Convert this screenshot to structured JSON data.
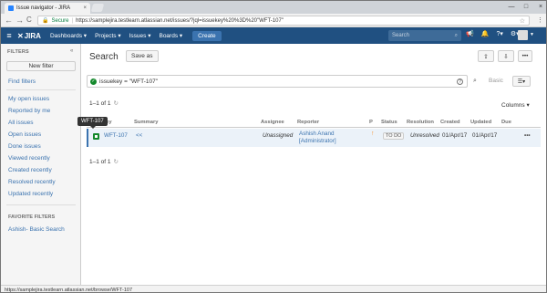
{
  "browser": {
    "tab_title": "Issue navigator - JIRA",
    "tab_close": "×",
    "window_controls": [
      "—",
      "□",
      "×"
    ],
    "back_glyph": "←",
    "forward_glyph": "→",
    "reload_glyph": "C",
    "secure_label": "Secure",
    "url": "https://samplejira.testlearn.atlassian.net/issues/?jql=issuekey%20%3D%20\"WFT-107\"",
    "status_url": "https://samplejira.testlearn.atlassian.net/browse/WFT-107"
  },
  "header": {
    "logo": "JIRA",
    "nav": [
      "Dashboards ▾",
      "Projects ▾",
      "Issues ▾",
      "Boards ▾"
    ],
    "create": "Create",
    "search_placeholder": "Search",
    "icons": [
      "megaphone-icon",
      "bell-icon",
      "help-icon",
      "settings-icon"
    ]
  },
  "sidebar": {
    "heading": "FILTERS",
    "collapse": "«",
    "new_filter": "New filter",
    "find_filters": "Find filters",
    "items": [
      "My open issues",
      "Reported by me",
      "All issues",
      "Open issues",
      "Done issues",
      "Viewed recently",
      "Created recently",
      "Resolved recently",
      "Updated recently"
    ],
    "favorites_heading": "FAVORITE FILTERS",
    "favorites": [
      "Ashish- Basic Search"
    ]
  },
  "main": {
    "title": "Search",
    "save_as": "Save as",
    "jql": "issuekey = \"WFT-107\"",
    "help_glyph": "?",
    "basic": "Basic",
    "pager_top": "1–1 of 1",
    "pager_bottom": "1–1 of 1",
    "columns_label": "Columns ▾",
    "tooltip": "WFT-107",
    "headers": [
      "Key",
      "Summary",
      "Assignee",
      "Reporter",
      "P",
      "Status",
      "Resolution",
      "Created",
      "Updated",
      "Due"
    ],
    "row": {
      "key": "WFT-107",
      "summary": "<<",
      "assignee": "Unassigned",
      "reporter_name": "Ashish Anand",
      "reporter_role": "[Administrator]",
      "priority_glyph": "↑",
      "status": "TO DO",
      "resolution": "Unresolved",
      "created": "01/Apr/17",
      "updated": "01/Apr/17",
      "due": "",
      "actions": "•••"
    }
  },
  "colors": {
    "header_bg": "#205081",
    "link": "#3b73af",
    "row_highlight": "#ebf2f9",
    "story_icon": "#14892c",
    "priority": "#f79232"
  }
}
